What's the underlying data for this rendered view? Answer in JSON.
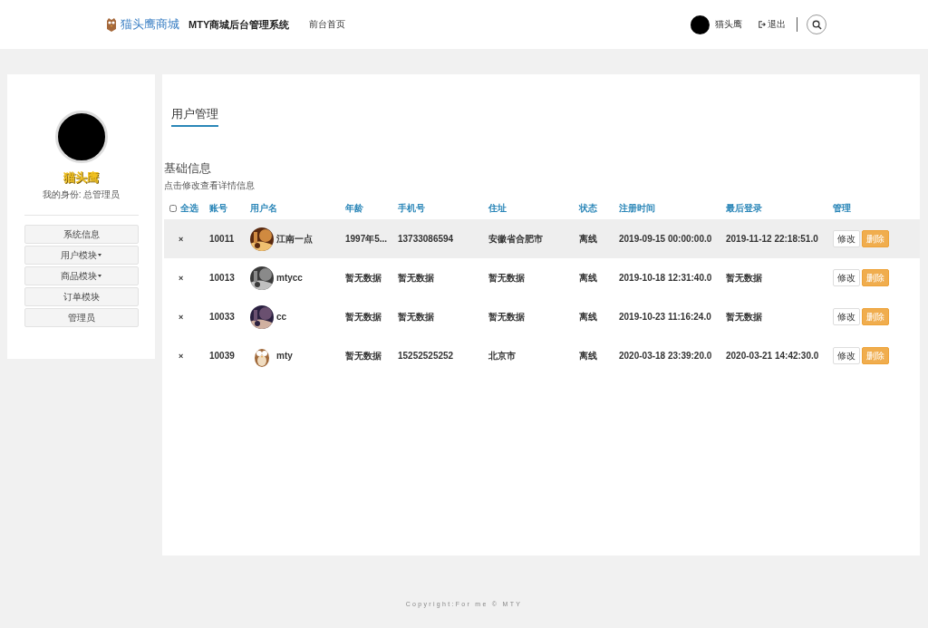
{
  "header": {
    "brand": "猫头鹰商城",
    "system_title": "MTY商城后台管理系统",
    "nav_link": "前台首页",
    "user_name": "猫头鹰",
    "logout": "退出"
  },
  "sidebar": {
    "name": "猫头鹰",
    "role": "我的身份: 总管理员",
    "menu": [
      {
        "label": "系统信息",
        "has_dropdown": false
      },
      {
        "label": "用户模块",
        "has_dropdown": true
      },
      {
        "label": "商品模块",
        "has_dropdown": true
      },
      {
        "label": "订单模块",
        "has_dropdown": false
      },
      {
        "label": "管理员",
        "has_dropdown": false
      }
    ]
  },
  "page_tab": "用户管理",
  "section": {
    "title": "基础信息",
    "hint": "点击修改查看详情信息"
  },
  "table": {
    "select_all": {
      "label": "全选",
      "checked": false
    },
    "columns": [
      "账号",
      "用户名",
      "年龄",
      "手机号",
      "住址",
      "状态",
      "注册时间",
      "最后登录",
      "管理"
    ],
    "rows": [
      {
        "mark": "×",
        "account": "10011",
        "username": "江南一点",
        "age": "1997年5...",
        "phone": "13733086594",
        "address": "安徽省合肥市",
        "status": "离线",
        "registered": "2019-09-15 00:00:00.0",
        "last_login": "2019-11-12 22:18:51.0",
        "edit": "修改",
        "delete": "删除",
        "selected": true
      },
      {
        "mark": "×",
        "account": "10013",
        "username": "mtycc",
        "age": "暂无数据",
        "phone": "暂无数据",
        "address": "暂无数据",
        "status": "离线",
        "registered": "2019-10-18 12:31:40.0",
        "last_login": "暂无数据",
        "edit": "修改",
        "delete": "删除",
        "selected": false
      },
      {
        "mark": "×",
        "account": "10033",
        "username": "cc",
        "age": "暂无数据",
        "phone": "暂无数据",
        "address": "暂无数据",
        "status": "离线",
        "registered": "2019-10-23 11:16:24.0",
        "last_login": "暂无数据",
        "edit": "修改",
        "delete": "删除",
        "selected": false
      },
      {
        "mark": "×",
        "account": "10039",
        "username": "mty",
        "age": "暂无数据",
        "phone": "15252525252",
        "address": "北京市",
        "status": "离线",
        "registered": "2020-03-18 23:39:20.0",
        "last_login": "2020-03-21 14:42:30.0",
        "edit": "修改",
        "delete": "删除",
        "selected": false
      }
    ]
  },
  "footer": "Copyright:For me © MTY"
}
